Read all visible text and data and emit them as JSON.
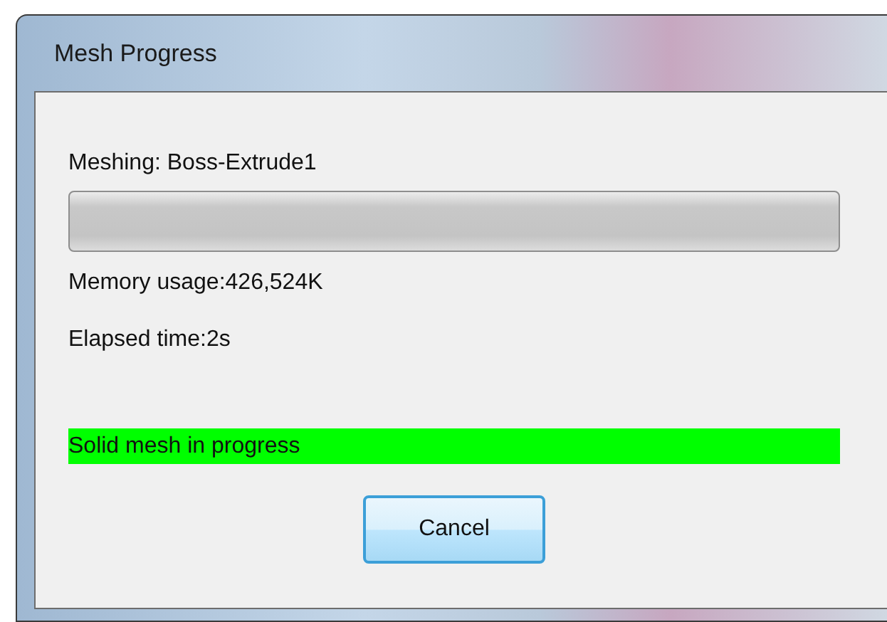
{
  "window": {
    "title": "Mesh Progress"
  },
  "progress": {
    "label": "Meshing: Boss-Extrude1",
    "level": 0
  },
  "info": [
    "Memory usage:426,524K",
    "Elapsed time:2s"
  ],
  "status": {
    "text": "Solid mesh in progress"
  },
  "buttons": [
    "Cancel"
  ]
}
